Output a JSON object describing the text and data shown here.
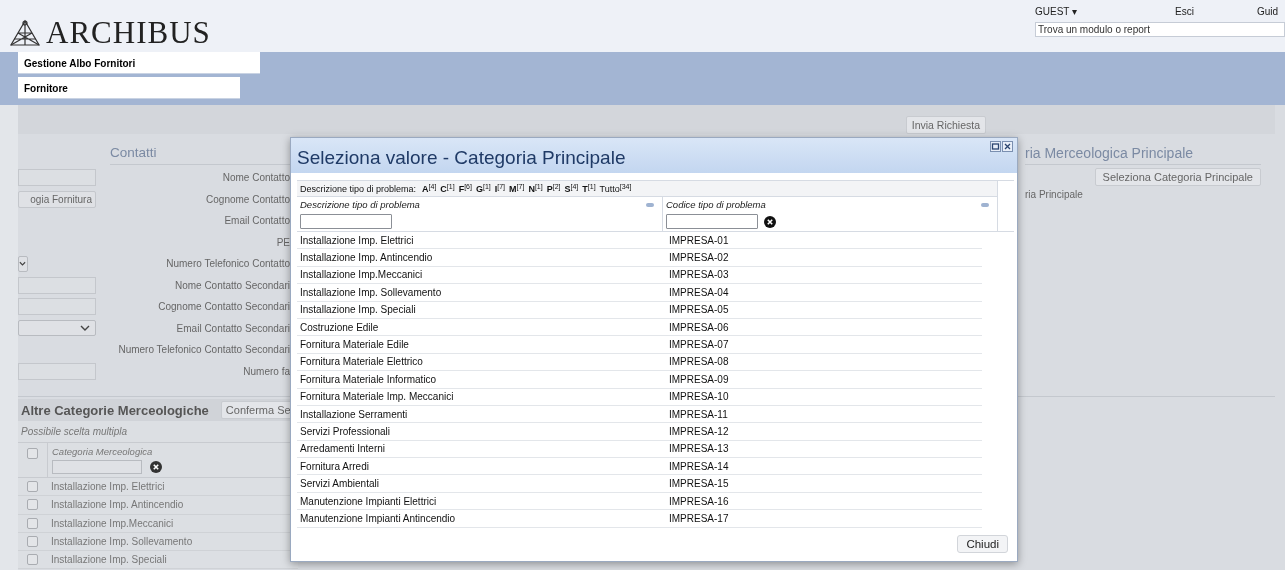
{
  "header": {
    "logo": "ARCHIBUS",
    "user_menu": "GUEST ▾",
    "logout": "Esci",
    "help": "Guid",
    "search": {
      "placeholder": "Trova un modulo o report"
    }
  },
  "breadcrumbs": [
    {
      "label": "Gestione Albo Fornitori"
    },
    {
      "label": "Fornitore"
    }
  ],
  "toolbar": {
    "buttons": [
      "Invia Richiesta"
    ]
  },
  "left_panel": {
    "items": [
      {
        "kind": "input"
      },
      {
        "kind": "button",
        "label": "ogia Fornitura"
      },
      {
        "kind": "spacer"
      },
      {
        "kind": "spacer"
      },
      {
        "kind": "select_cut"
      },
      {
        "kind": "input"
      },
      {
        "kind": "input"
      },
      {
        "kind": "select"
      },
      {
        "kind": "spacer"
      },
      {
        "kind": "input"
      }
    ]
  },
  "contacts": {
    "title": "Contatti",
    "labels": [
      "Nome Contatto",
      "Cognome Contatto",
      "Email Contatto",
      "PE",
      "Numero Telefonico Contatto",
      "Nome Contatto Secondari",
      "Cognome Contatto Secondari",
      "Email Contatto Secondari",
      "Numero Telefonico Contatto Secondari",
      "Numero fa"
    ]
  },
  "main_category": {
    "title": "ria Merceologica Principale",
    "button": "Seleziona Categoria Principale",
    "label": "ria Principale"
  },
  "other_categories": {
    "title": "Altre Categorie Merceologiche",
    "button": "Conferma Se",
    "subtitle": "Possibile scelta multipla",
    "column": "Categoria Merceologica",
    "select_all_checked": false,
    "rows": [
      {
        "label": "Installazione Imp. Elettrici",
        "checked": false
      },
      {
        "label": "Installazione Imp. Antincendio",
        "checked": false
      },
      {
        "label": "Installazione Imp.Meccanici",
        "checked": false
      },
      {
        "label": "Installazione Imp. Sollevamento",
        "checked": false
      },
      {
        "label": "Installazione Imp. Speciali",
        "checked": false
      }
    ]
  },
  "dialog": {
    "title": "Seleziona valore - Categoria Principale",
    "index_label": "Descrizione tipo di problema:",
    "index": [
      {
        "kind": "letter",
        "letter": "A",
        "count": "[4]"
      },
      {
        "kind": "letter",
        "letter": "C",
        "count": "[1]"
      },
      {
        "kind": "letter",
        "letter": "F",
        "count": "[6]"
      },
      {
        "kind": "letter",
        "letter": "G",
        "count": "[1]"
      },
      {
        "kind": "letter",
        "letter": "I",
        "count": "[7]"
      },
      {
        "kind": "letter",
        "letter": "M",
        "count": "[7]"
      },
      {
        "kind": "letter",
        "letter": "N",
        "count": "[1]"
      },
      {
        "kind": "letter",
        "letter": "P",
        "count": "[2]"
      },
      {
        "kind": "letter",
        "letter": "S",
        "count": "[4]"
      },
      {
        "kind": "letter",
        "letter": "T",
        "count": "[1]"
      },
      {
        "kind": "all",
        "letter": "Tutto",
        "count": "[34]"
      }
    ],
    "columns": [
      {
        "label": "Descrizione tipo di problema"
      },
      {
        "label": "Codice tipo di problema",
        "clear_button": true
      }
    ],
    "rows": [
      {
        "description": "Installazione Imp. Elettrici",
        "code": "IMPRESA-01"
      },
      {
        "description": "Installazione Imp. Antincendio",
        "code": "IMPRESA-02"
      },
      {
        "description": "Installazione Imp.Meccanici",
        "code": "IMPRESA-03"
      },
      {
        "description": "Installazione Imp. Sollevamento",
        "code": "IMPRESA-04"
      },
      {
        "description": "Installazione Imp. Speciali",
        "code": "IMPRESA-05"
      },
      {
        "description": "Costruzione Edile",
        "code": "IMPRESA-06"
      },
      {
        "description": "Fornitura Materiale Edile",
        "code": "IMPRESA-07"
      },
      {
        "description": "Fornitura Materiale Elettrico",
        "code": "IMPRESA-08"
      },
      {
        "description": "Fornitura Materiale Informatico",
        "code": "IMPRESA-09"
      },
      {
        "description": "Fornitura Materiale Imp. Meccanici",
        "code": "IMPRESA-10"
      },
      {
        "description": "Installazione Serramenti",
        "code": "IMPRESA-11"
      },
      {
        "description": "Servizi Professionali",
        "code": "IMPRESA-12"
      },
      {
        "description": "Arredamenti Interni",
        "code": "IMPRESA-13"
      },
      {
        "description": "Fornitura Arredi",
        "code": "IMPRESA-14"
      },
      {
        "description": "Servizi Ambientali",
        "code": "IMPRESA-15"
      },
      {
        "description": "Manutenzione Impianti Elettrici",
        "code": "IMPRESA-16"
      },
      {
        "description": "Manutenzione Impianti Antincendio",
        "code": "IMPRESA-17"
      }
    ],
    "buttons": [
      "Chiudi"
    ]
  }
}
